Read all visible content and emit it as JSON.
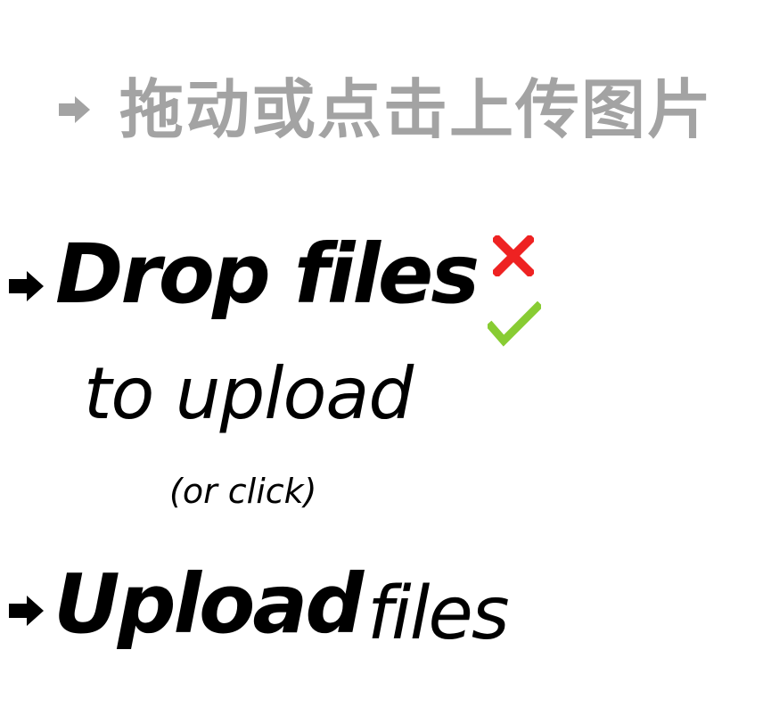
{
  "upload_prompt_cn": {
    "arrow_icon": "right-arrow-icon",
    "text": "拖动或点击上传图片",
    "color": "#a3a3a3"
  },
  "drop_zone": {
    "arrow_icon": "right-arrow-icon",
    "title": "Drop files",
    "subtitle": "to upload",
    "hint": "(or click)",
    "error_icon": "cross-icon",
    "error_color": "#ee2222",
    "success_icon": "checkmark-icon",
    "success_color": "#88cc33"
  },
  "upload_button": {
    "arrow_icon": "right-arrow-icon",
    "title_bold": "Upload",
    "title_light": "files"
  }
}
